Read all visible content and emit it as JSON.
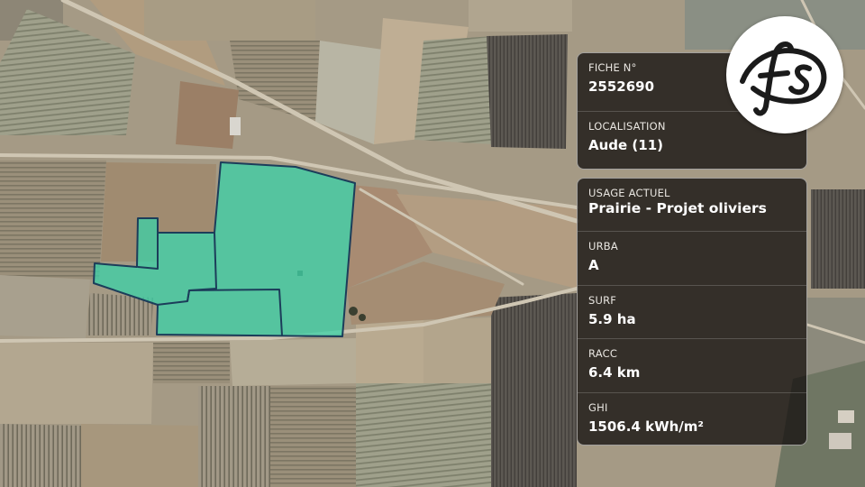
{
  "fiche": {
    "label": "FICHE N°",
    "value": "2552690"
  },
  "localisation": {
    "label": "LOCALISATION",
    "value": "Aude (11)"
  },
  "details": [
    {
      "key": "usage",
      "label": "USAGE ACTUEL",
      "value": "Prairie - Projet oliviers"
    },
    {
      "key": "urba",
      "label": "URBA",
      "value": "A"
    },
    {
      "key": "surf",
      "label": "SURF",
      "value": "5.9 ha"
    },
    {
      "key": "racc",
      "label": "RACC",
      "value": "6.4 km"
    },
    {
      "key": "ghi",
      "label": "GHI",
      "value": "1506.4 kWh/m²"
    }
  ],
  "logo": {
    "text": "fs",
    "icon": "fs-monogram-logo"
  },
  "colors": {
    "parcel_fill": "#3fcfa6",
    "parcel_stroke": "#1c3d5a",
    "card_bg": "#181412",
    "logo_ink": "#1b1b1b"
  },
  "map": {
    "type": "satellite-imagery",
    "highlighted_parcel": "selected-parcel"
  }
}
